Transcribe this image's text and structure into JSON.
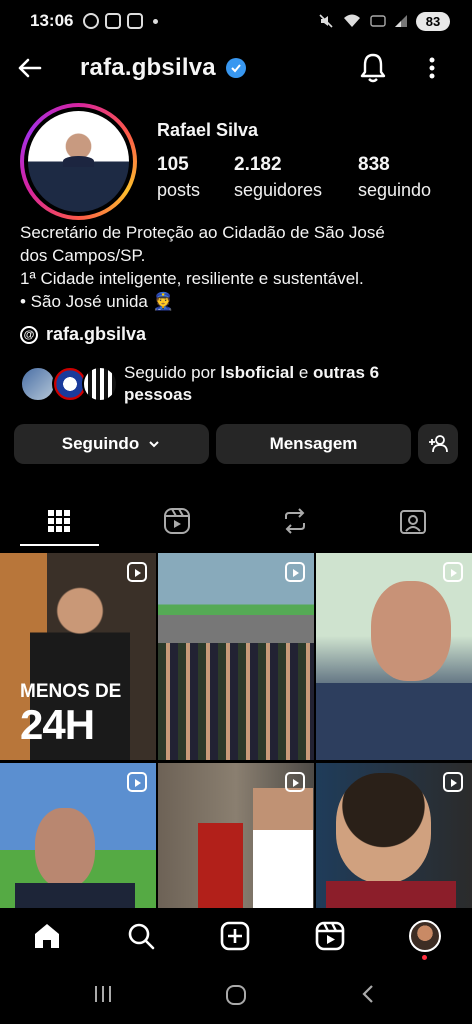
{
  "status_bar": {
    "time": "13:06",
    "battery": "83"
  },
  "header": {
    "username": "rafa.gbsilva",
    "verified_icon": "verified-badge-icon"
  },
  "profile": {
    "full_name": "Rafael Silva",
    "stats": [
      {
        "value": "105",
        "label": "posts"
      },
      {
        "value": "2.182",
        "label": "seguidores"
      },
      {
        "value": "838",
        "label": "seguindo"
      }
    ],
    "bio_lines": [
      "Secretário de Proteção ao Cidadão de São José",
      "dos Campos/SP.",
      "1ª Cidade inteligente, resiliente e sustentável.",
      "• São José unida 👮"
    ],
    "threads_handle": "rafa.gbsilva",
    "followed_by": {
      "prefix": "Seguido por ",
      "account": "lsboficial",
      "middle": " e ",
      "others": "outras 6",
      "suffix": "pessoas"
    }
  },
  "actions": {
    "following_label": "Seguindo",
    "message_label": "Mensagem"
  },
  "tabs": [
    "grid-icon",
    "reels-icon",
    "reposts-icon",
    "tagged-icon"
  ],
  "grid": {
    "overlay_line1": "MENOS DE",
    "overlay_line2": "24H"
  },
  "colors": {
    "background": "#000000",
    "button": "#262626",
    "verified": "#3897f0",
    "notification_dot": "#ff3040"
  }
}
